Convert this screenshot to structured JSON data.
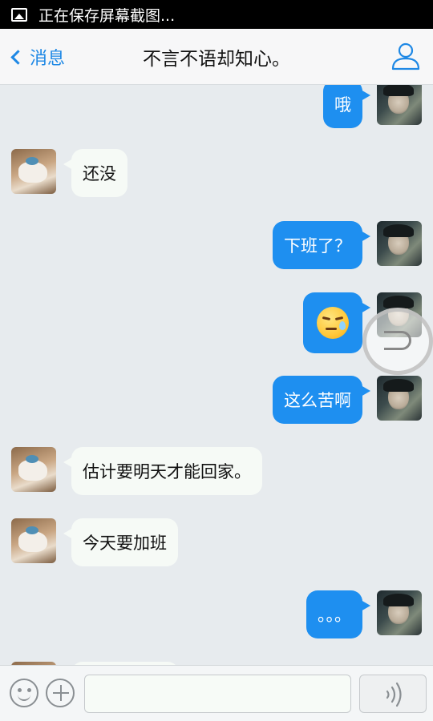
{
  "status_bar": {
    "text": "正在保存屏幕截图..."
  },
  "nav": {
    "back_label": "消息",
    "title": "不言不语却知心。"
  },
  "messages": [
    {
      "from": "me",
      "text": "哦"
    },
    {
      "from": "other",
      "text": "还没"
    },
    {
      "from": "me",
      "text": "下班了？"
    },
    {
      "from": "me",
      "type": "emoji",
      "emoji": "sweat-emoji"
    },
    {
      "from": "me",
      "text": "这么苦啊"
    },
    {
      "from": "other",
      "text": "估计要明天才能回家。"
    },
    {
      "from": "other",
      "text": "今天要加班"
    },
    {
      "from": "me",
      "text": "。。。"
    }
  ],
  "input_bar": {
    "placeholder": ""
  },
  "colors": {
    "accent": "#1e88e5",
    "my_bubble": "#1e8ff0",
    "other_bubble": "#f6faf6",
    "background": "#e7ebee"
  }
}
